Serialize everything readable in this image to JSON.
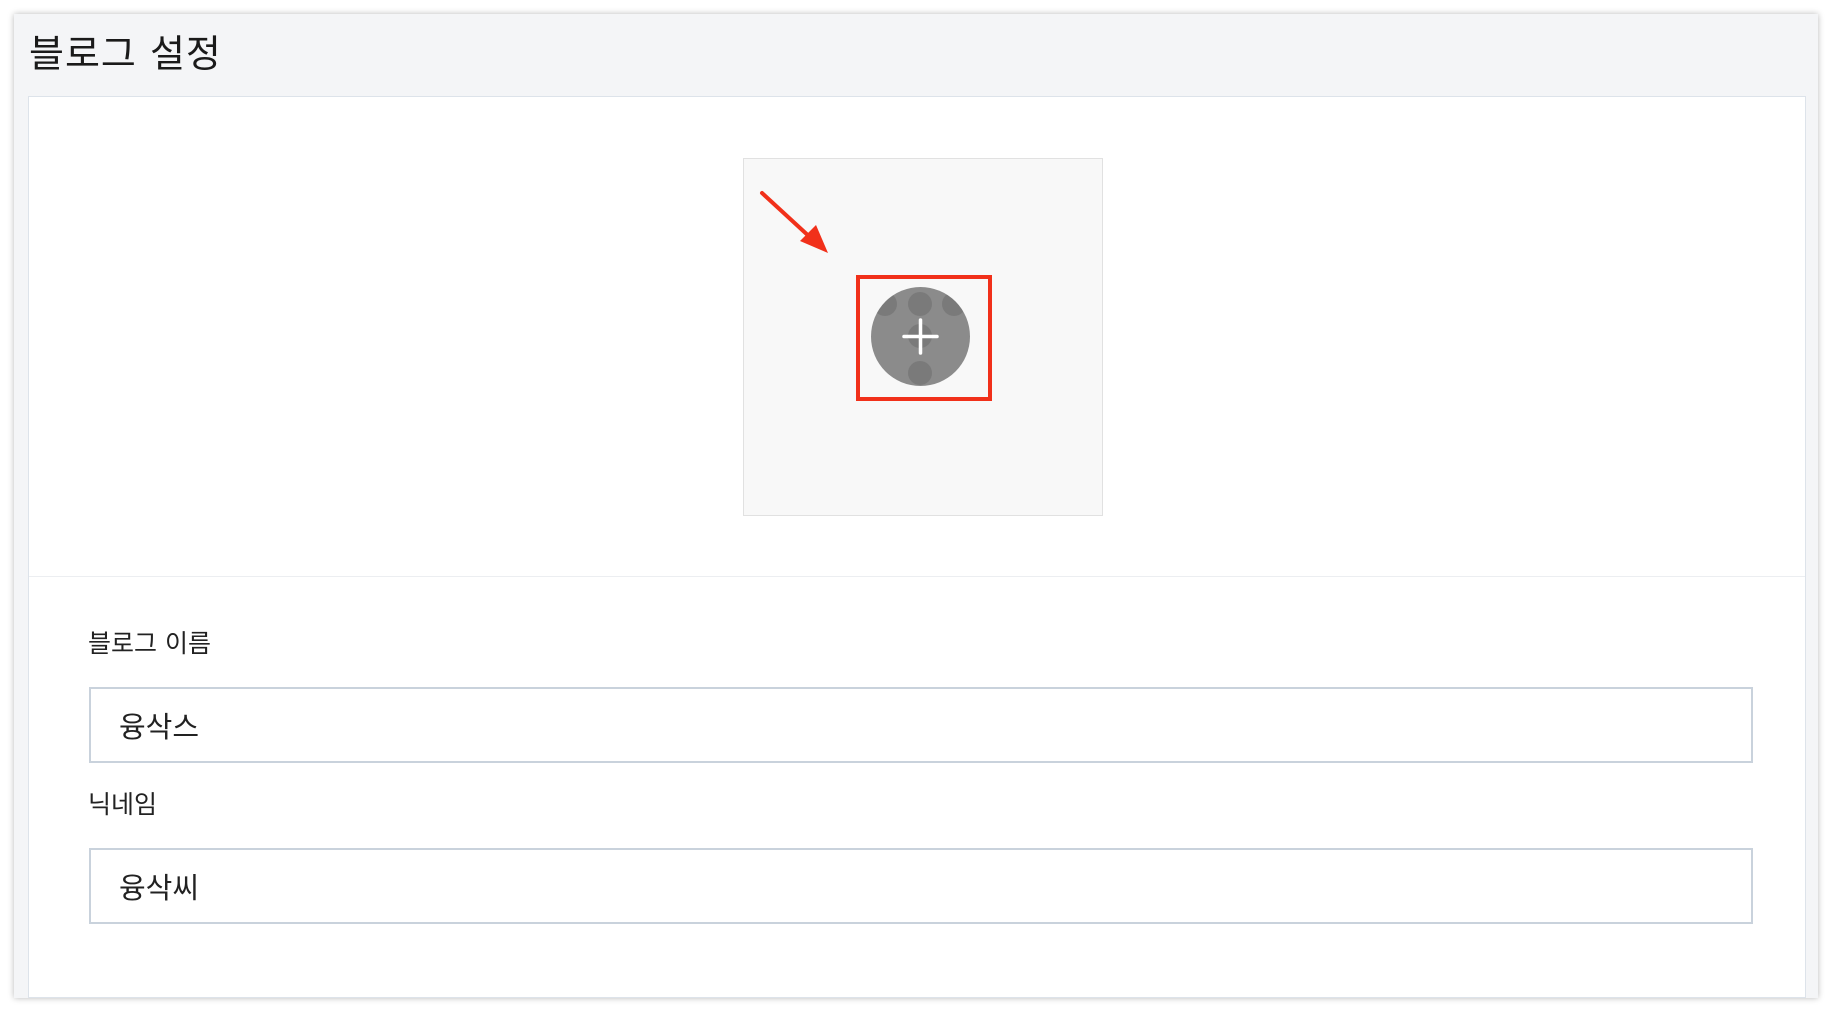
{
  "header": {
    "title": "블로그 설정"
  },
  "profile_image": {
    "upload_button_icon": "plus-icon",
    "annotation": {
      "highlight_color": "#f1301a",
      "arrow_color": "#f1301a"
    }
  },
  "form": {
    "blog_name": {
      "label": "블로그 이름",
      "value": "융삭스"
    },
    "nickname": {
      "label": "닉네임",
      "value": "융삭씨"
    }
  }
}
